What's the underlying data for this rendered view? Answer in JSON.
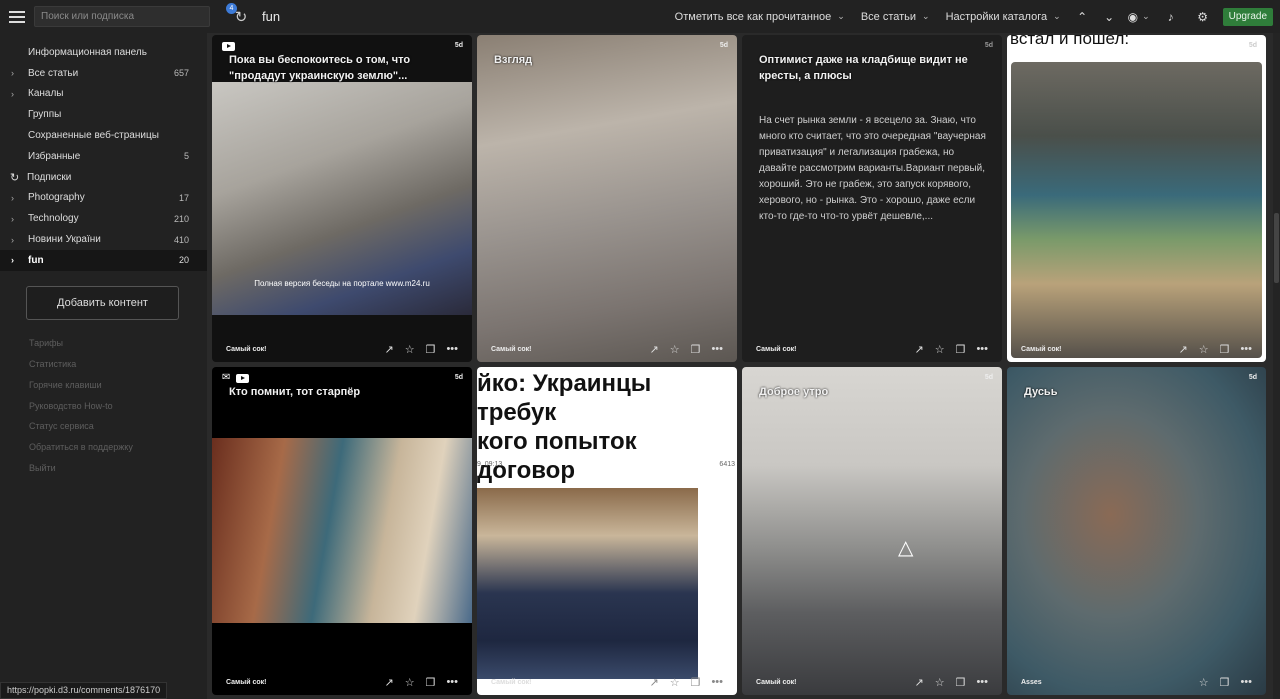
{
  "search": {
    "placeholder": "Поиск или подписка"
  },
  "refresh_badge": "4",
  "feed_title": "fun",
  "toolbar": {
    "mark_all_read": "Отметить все как прочитанное",
    "all_articles": "Все статьи",
    "catalog_settings": "Настройки каталога",
    "upgrade": "Upgrade"
  },
  "sidebar": {
    "items": [
      {
        "label": "Информационная панель",
        "count": ""
      },
      {
        "label": "Все статьи",
        "count": "657"
      },
      {
        "label": "Каналы",
        "count": ""
      },
      {
        "label": "Группы",
        "count": ""
      },
      {
        "label": "Сохраненные веб-страницы",
        "count": ""
      },
      {
        "label": "Избранные",
        "count": "5"
      }
    ],
    "subscriptions_label": "Подписки",
    "feeds": [
      {
        "label": "Photography",
        "count": "17"
      },
      {
        "label": "Technology",
        "count": "210"
      },
      {
        "label": "Новини України",
        "count": "410"
      },
      {
        "label": "fun",
        "count": "20"
      }
    ],
    "add_content": "Добавить контент",
    "links": [
      "Тарифы",
      "Статистика",
      "Горячие клавиши",
      "Руководство How-to",
      "Статус сервиса",
      "Обратиться в поддержку",
      "Выйти"
    ]
  },
  "cards": [
    {
      "title": "Пока вы беспокоитесь о том, что \"продадут украинскую землю\"...",
      "age": "5d",
      "source": "Самый сок!",
      "caption": "Полная версия беседы на портале www.m24.ru"
    },
    {
      "title": "Взгляд",
      "age": "5d",
      "source": "Самый сок!"
    },
    {
      "title": "Оптимист даже на кладбище видит не кресты, а плюсы",
      "age": "5d",
      "source": "Самый сок!",
      "text": "На счет рынка земли - я всецело за. Знаю, что много кто считает, что это очередная \"ваучерная приватизация\" и легализация грабежа, но давайте рассмотрим варианты.Вариант первый, хороший. Это не грабеж, это запуск корявого, херового, но - рынка. Это - хорошо, даже если кто-то где-то что-то урвёт дешевле,..."
    },
    {
      "title": "встал и пошел:",
      "age": "5d",
      "source": "Самый сок!"
    },
    {
      "title": "Кто помнит, тот старпёр",
      "age": "5d",
      "source": "Самый сок!"
    },
    {
      "title": "йко: Украинцы требук\nкого попыток договор\nым",
      "age": "",
      "source": "Самый сок!",
      "date": "9, 09:13",
      "views": "6413"
    },
    {
      "title": "Доброе утро",
      "age": "5d",
      "source": "Самый сок!"
    },
    {
      "title": "Дусьь",
      "age": "5d",
      "source": "Asses"
    }
  ],
  "status_url": "https://popki.d3.ru/comments/1876170",
  "colors": {
    "accent": "#3d7bd8",
    "upgrade": "#2f7d3a",
    "sidebar_bg": "#222222",
    "active_bg": "#161616"
  }
}
